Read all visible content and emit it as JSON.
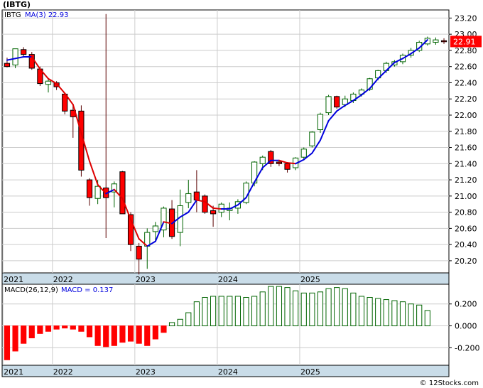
{
  "title": "(IBTG)",
  "credit": "© 12Stocks.com",
  "colors": {
    "up_fill": "#ffffff",
    "up_stroke": "#006400",
    "down_fill": "#ff0000",
    "down_stroke": "#000000",
    "ma_line": "#0000dd",
    "ma_line_down": "#dd0000",
    "axis_band": "#c9dce8",
    "grid": "#cccccc",
    "price_tag_bg": "#ff0000",
    "price_tag_text": "#ffffff",
    "macd_pos": "#006400",
    "macd_neg": "#ff0000"
  },
  "chart_data": [
    {
      "type": "candlestick",
      "title": "IBTG",
      "legend": [
        {
          "label": "IBTG",
          "color": "#000000"
        },
        {
          "label": "MA(3)",
          "color": "#0000dd",
          "value": "22.93"
        }
      ],
      "last_price": "22.91",
      "y_ticks": [
        "23.20",
        "23.00",
        "22.80",
        "22.60",
        "22.40",
        "22.20",
        "22.00",
        "21.80",
        "21.60",
        "21.40",
        "21.20",
        "21.00",
        "20.80",
        "20.60",
        "20.40",
        "20.20"
      ],
      "ylim": [
        20.05,
        23.3
      ],
      "x_ticks": [
        "2021",
        "2022",
        "2023",
        "2024",
        "2025"
      ],
      "x_tick_index": [
        0,
        6,
        16,
        26,
        36
      ],
      "grid": true,
      "candles": [
        {
          "o": 22.64,
          "h": 22.71,
          "l": 22.59,
          "c": 22.6
        },
        {
          "o": 22.62,
          "h": 22.78,
          "l": 22.58,
          "c": 22.82
        },
        {
          "o": 22.81,
          "h": 22.84,
          "l": 22.73,
          "c": 22.75
        },
        {
          "o": 22.75,
          "h": 22.78,
          "l": 22.56,
          "c": 22.58
        },
        {
          "o": 22.57,
          "h": 22.6,
          "l": 22.36,
          "c": 22.39
        },
        {
          "o": 22.38,
          "h": 22.46,
          "l": 22.28,
          "c": 22.42
        },
        {
          "o": 22.4,
          "h": 22.42,
          "l": 22.31,
          "c": 22.35
        },
        {
          "o": 22.26,
          "h": 22.27,
          "l": 22.01,
          "c": 22.05
        },
        {
          "o": 22.06,
          "h": 22.14,
          "l": 21.72,
          "c": 21.98
        },
        {
          "o": 22.05,
          "h": 22.12,
          "l": 21.24,
          "c": 21.32
        },
        {
          "o": 21.2,
          "h": 21.22,
          "l": 20.88,
          "c": 20.98
        },
        {
          "o": 20.97,
          "h": 21.2,
          "l": 20.9,
          "c": 21.12
        },
        {
          "o": 21.1,
          "h": 23.25,
          "l": 20.48,
          "c": 20.98
        },
        {
          "o": 21.05,
          "h": 21.18,
          "l": 20.86,
          "c": 21.15
        },
        {
          "o": 21.3,
          "h": 21.31,
          "l": 20.78,
          "c": 20.78
        },
        {
          "o": 20.77,
          "h": 20.8,
          "l": 20.32,
          "c": 20.4
        },
        {
          "o": 20.38,
          "h": 20.42,
          "l": 20.03,
          "c": 20.22
        },
        {
          "o": 20.38,
          "h": 20.6,
          "l": 20.1,
          "c": 20.55
        },
        {
          "o": 20.56,
          "h": 20.68,
          "l": 20.45,
          "c": 20.63
        }
      ],
      "candles_note": "series continues below",
      "candles_2": [
        {
          "o": 20.58,
          "h": 20.87,
          "l": 20.49,
          "c": 20.85
        },
        {
          "o": 20.84,
          "h": 20.95,
          "l": 20.47,
          "c": 20.5
        },
        {
          "o": 20.55,
          "h": 21.08,
          "l": 20.38,
          "c": 20.88
        },
        {
          "o": 20.92,
          "h": 21.2,
          "l": 20.85,
          "c": 21.03
        },
        {
          "o": 21.05,
          "h": 21.32,
          "l": 20.8,
          "c": 20.95
        },
        {
          "o": 21.0,
          "h": 21.02,
          "l": 20.78,
          "c": 20.8
        },
        {
          "o": 20.82,
          "h": 20.88,
          "l": 20.62,
          "c": 20.78
        },
        {
          "o": 20.8,
          "h": 20.92,
          "l": 20.74,
          "c": 20.9
        },
        {
          "o": 20.82,
          "h": 20.92,
          "l": 20.7,
          "c": 20.85
        },
        {
          "o": 20.85,
          "h": 20.96,
          "l": 20.78,
          "c": 20.93
        },
        {
          "o": 20.92,
          "h": 21.18,
          "l": 20.9,
          "c": 21.16
        },
        {
          "o": 21.16,
          "h": 21.43,
          "l": 21.12,
          "c": 21.42
        },
        {
          "o": 21.4,
          "h": 21.5,
          "l": 21.32,
          "c": 21.48
        },
        {
          "o": 21.55,
          "h": 21.57,
          "l": 21.36,
          "c": 21.4
        },
        {
          "o": 21.42,
          "h": 21.44,
          "l": 21.37,
          "c": 21.4
        },
        {
          "o": 21.4,
          "h": 21.42,
          "l": 21.29,
          "c": 21.33
        },
        {
          "o": 21.35,
          "h": 21.48,
          "l": 21.32,
          "c": 21.47
        },
        {
          "o": 21.48,
          "h": 21.6,
          "l": 21.45,
          "c": 21.58
        },
        {
          "o": 21.62,
          "h": 21.8,
          "l": 21.6,
          "c": 21.79
        },
        {
          "o": 21.82,
          "h": 22.03,
          "l": 21.78,
          "c": 22.01
        },
        {
          "o": 22.03,
          "h": 22.25,
          "l": 22.0,
          "c": 22.23
        },
        {
          "o": 22.23,
          "h": 22.24,
          "l": 22.08,
          "c": 22.1
        },
        {
          "o": 22.13,
          "h": 22.24,
          "l": 22.1,
          "c": 22.2
        },
        {
          "o": 22.18,
          "h": 22.28,
          "l": 22.15,
          "c": 22.26
        },
        {
          "o": 22.26,
          "h": 22.33,
          "l": 22.23,
          "c": 22.31
        },
        {
          "o": 22.32,
          "h": 22.46,
          "l": 22.3,
          "c": 22.45
        },
        {
          "o": 22.46,
          "h": 22.56,
          "l": 22.43,
          "c": 22.55
        },
        {
          "o": 22.55,
          "h": 22.66,
          "l": 22.52,
          "c": 22.64
        },
        {
          "o": 22.62,
          "h": 22.68,
          "l": 22.6,
          "c": 22.66
        },
        {
          "o": 22.66,
          "h": 22.76,
          "l": 22.63,
          "c": 22.74
        },
        {
          "o": 22.74,
          "h": 22.83,
          "l": 22.71,
          "c": 22.8
        },
        {
          "o": 22.8,
          "h": 22.92,
          "l": 22.78,
          "c": 22.9
        },
        {
          "o": 22.88,
          "h": 22.97,
          "l": 22.86,
          "c": 22.95
        },
        {
          "o": 22.9,
          "h": 22.96,
          "l": 22.87,
          "c": 22.93
        },
        {
          "o": 22.92,
          "h": 22.95,
          "l": 22.88,
          "c": 22.91
        }
      ],
      "ma3": [
        22.68,
        22.7,
        22.72,
        22.72,
        22.57,
        22.45,
        22.39,
        22.27,
        22.13,
        21.78,
        21.43,
        21.14,
        21.03,
        21.08,
        20.97,
        20.71,
        20.47,
        20.38,
        20.44,
        20.68,
        20.66,
        20.74,
        20.8,
        20.95,
        20.93,
        20.85,
        20.84,
        20.84,
        20.89,
        20.98,
        21.17,
        21.35,
        21.44,
        21.44,
        21.41,
        21.4,
        21.45,
        21.53,
        21.69,
        21.93,
        22.05,
        22.12,
        22.18,
        22.25,
        22.33,
        22.45,
        22.55,
        22.65,
        22.7,
        22.76,
        22.83,
        22.93
      ]
    },
    {
      "type": "bar",
      "title": "MACD(26,12,9)",
      "legend": [
        {
          "label": "MACD(26,12,9)",
          "color": "#000000"
        },
        {
          "label": "MACD",
          "color": "#0000dd",
          "value": "0.137"
        }
      ],
      "y_ticks": [
        "0.200",
        "0.000",
        "-0.200"
      ],
      "ylim": [
        -0.36,
        0.38
      ],
      "grid": true,
      "x_ticks": [
        "2021",
        "2022",
        "2023",
        "2024",
        "2025"
      ],
      "values": [
        -0.31,
        -0.23,
        -0.16,
        -0.11,
        -0.07,
        -0.05,
        -0.03,
        -0.02,
        -0.03,
        -0.05,
        -0.1,
        -0.18,
        -0.19,
        -0.18,
        -0.15,
        -0.14,
        -0.16,
        -0.18,
        -0.12,
        -0.06,
        0.03,
        0.06,
        0.12,
        0.22,
        0.26,
        0.27,
        0.27,
        0.27,
        0.27,
        0.26,
        0.27,
        0.31,
        0.36,
        0.36,
        0.35,
        0.32,
        0.3,
        0.3,
        0.31,
        0.34,
        0.35,
        0.34,
        0.3,
        0.27,
        0.26,
        0.25,
        0.24,
        0.23,
        0.22,
        0.2,
        0.19,
        0.14
      ]
    }
  ]
}
